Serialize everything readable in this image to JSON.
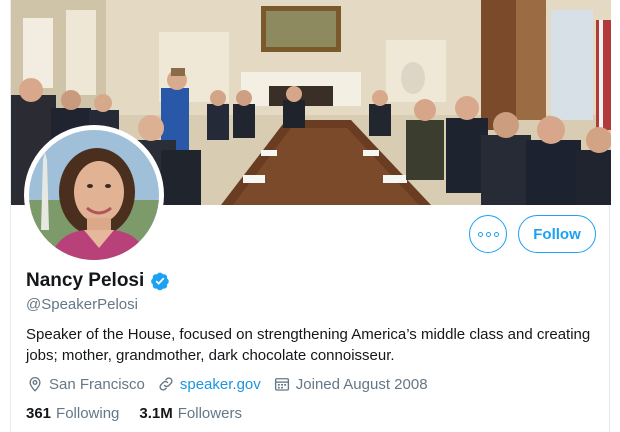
{
  "profile": {
    "display_name": "Nancy Pelosi",
    "handle": "@SpeakerPelosi",
    "verified": true,
    "bio": "Speaker of the House, focused on strengthening America’s middle class and creating jobs; mother, grandmother, dark chocolate connoisseur.",
    "location": "San Francisco",
    "website": "speaker.gov",
    "joined": "Joined August 2008"
  },
  "actions": {
    "follow_label": "Follow",
    "more_icon": "more-horizontal-icon"
  },
  "stats": {
    "following_count": "361",
    "following_label": "Following",
    "followers_count": "3.1M",
    "followers_label": "Followers"
  },
  "icons": {
    "location": "map-pin-icon",
    "website": "link-icon",
    "joined": "calendar-icon",
    "verified": "verified-badge-icon"
  },
  "colors": {
    "accent": "#1da1f2",
    "link": "#1b95e0",
    "muted": "#657786",
    "text": "#14171a"
  }
}
